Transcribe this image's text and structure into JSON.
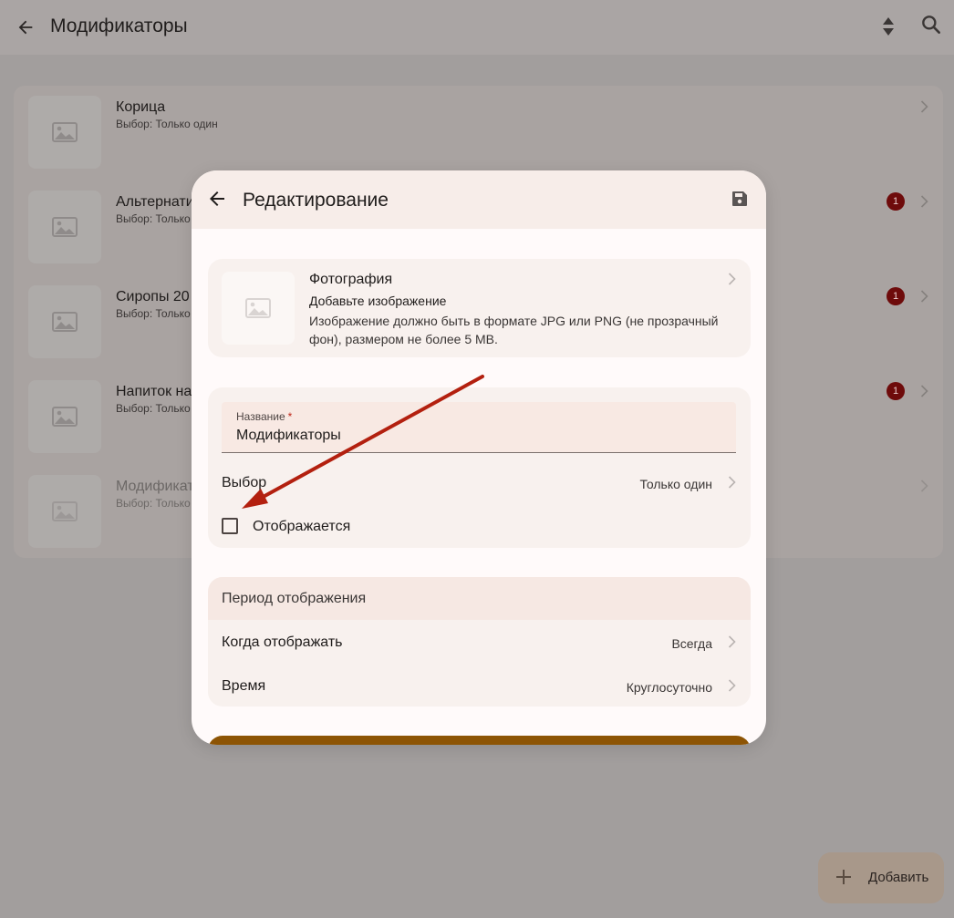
{
  "appbar": {
    "title": "Модификаторы",
    "icons": {
      "back": "arrow-left-icon",
      "sort": "sort-icon",
      "search": "search-icon"
    }
  },
  "list": [
    {
      "name": "Корица",
      "sub": "Выбор: Только один",
      "badge": ""
    },
    {
      "name": "Альтернатив",
      "sub": "Выбор: Только",
      "badge": "1"
    },
    {
      "name": "Сиропы 20",
      "sub": "Выбор: Только",
      "badge": "1"
    },
    {
      "name": "Напиток на",
      "sub": "Выбор: Только",
      "badge": "1"
    },
    {
      "name": "Модификат",
      "sub": "Выбор: Только",
      "badge": ""
    }
  ],
  "fab": {
    "label": "Добавить"
  },
  "dialog": {
    "title": "Редактирование",
    "photo": {
      "title": "Фотография",
      "subtitle": "Добавьте изображение",
      "hint": "Изображение должно быть в формате JPG или PNG (не прозрачный фон), размером не более 5 MB."
    },
    "name_field": {
      "label": "Название",
      "required_mark": "*",
      "value": "Модификаторы"
    },
    "choice": {
      "label": "Выбор",
      "value": "Только один"
    },
    "visible_checkbox": {
      "label": "Отображается",
      "checked": false
    },
    "period": {
      "header": "Период отображения",
      "when": {
        "label": "Когда отображать",
        "value": "Всегда"
      },
      "time": {
        "label": "Время",
        "value": "Круглосуточно"
      }
    }
  },
  "colors": {
    "accent": "#8d5404",
    "badge": "#6e0b0b",
    "annotation_arrow": "#b3200f"
  }
}
